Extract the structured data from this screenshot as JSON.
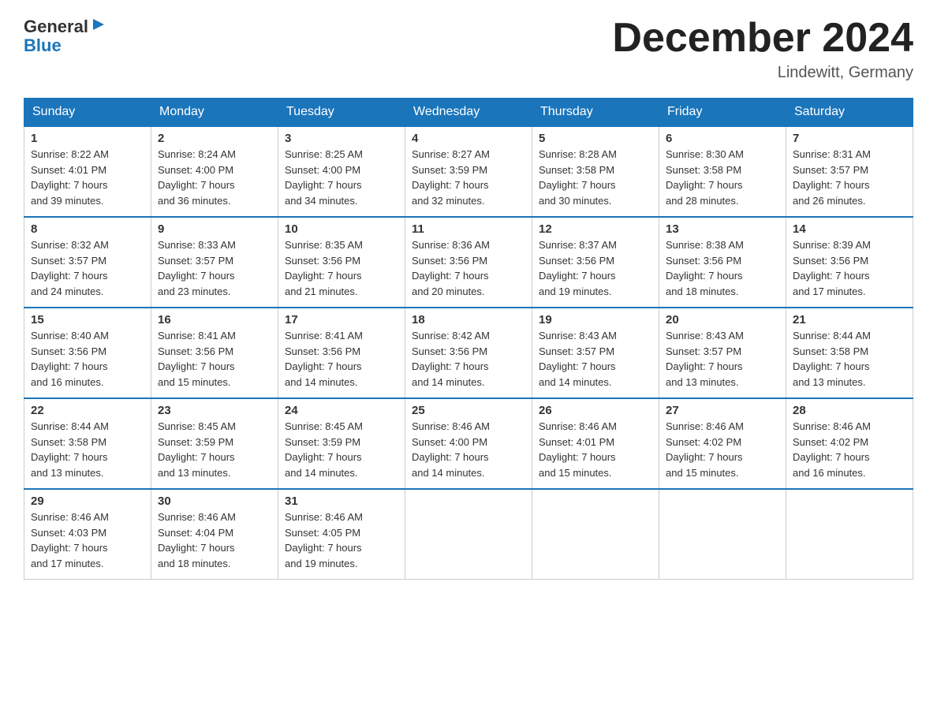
{
  "logo": {
    "text_general": "General",
    "text_blue": "Blue",
    "arrow": "▶"
  },
  "header": {
    "month_year": "December 2024",
    "location": "Lindewitt, Germany"
  },
  "days_of_week": [
    "Sunday",
    "Monday",
    "Tuesday",
    "Wednesday",
    "Thursday",
    "Friday",
    "Saturday"
  ],
  "weeks": [
    [
      {
        "day": "1",
        "sunrise": "8:22 AM",
        "sunset": "4:01 PM",
        "daylight": "7 hours and 39 minutes."
      },
      {
        "day": "2",
        "sunrise": "8:24 AM",
        "sunset": "4:00 PM",
        "daylight": "7 hours and 36 minutes."
      },
      {
        "day": "3",
        "sunrise": "8:25 AM",
        "sunset": "4:00 PM",
        "daylight": "7 hours and 34 minutes."
      },
      {
        "day": "4",
        "sunrise": "8:27 AM",
        "sunset": "3:59 PM",
        "daylight": "7 hours and 32 minutes."
      },
      {
        "day": "5",
        "sunrise": "8:28 AM",
        "sunset": "3:58 PM",
        "daylight": "7 hours and 30 minutes."
      },
      {
        "day": "6",
        "sunrise": "8:30 AM",
        "sunset": "3:58 PM",
        "daylight": "7 hours and 28 minutes."
      },
      {
        "day": "7",
        "sunrise": "8:31 AM",
        "sunset": "3:57 PM",
        "daylight": "7 hours and 26 minutes."
      }
    ],
    [
      {
        "day": "8",
        "sunrise": "8:32 AM",
        "sunset": "3:57 PM",
        "daylight": "7 hours and 24 minutes."
      },
      {
        "day": "9",
        "sunrise": "8:33 AM",
        "sunset": "3:57 PM",
        "daylight": "7 hours and 23 minutes."
      },
      {
        "day": "10",
        "sunrise": "8:35 AM",
        "sunset": "3:56 PM",
        "daylight": "7 hours and 21 minutes."
      },
      {
        "day": "11",
        "sunrise": "8:36 AM",
        "sunset": "3:56 PM",
        "daylight": "7 hours and 20 minutes."
      },
      {
        "day": "12",
        "sunrise": "8:37 AM",
        "sunset": "3:56 PM",
        "daylight": "7 hours and 19 minutes."
      },
      {
        "day": "13",
        "sunrise": "8:38 AM",
        "sunset": "3:56 PM",
        "daylight": "7 hours and 18 minutes."
      },
      {
        "day": "14",
        "sunrise": "8:39 AM",
        "sunset": "3:56 PM",
        "daylight": "7 hours and 17 minutes."
      }
    ],
    [
      {
        "day": "15",
        "sunrise": "8:40 AM",
        "sunset": "3:56 PM",
        "daylight": "7 hours and 16 minutes."
      },
      {
        "day": "16",
        "sunrise": "8:41 AM",
        "sunset": "3:56 PM",
        "daylight": "7 hours and 15 minutes."
      },
      {
        "day": "17",
        "sunrise": "8:41 AM",
        "sunset": "3:56 PM",
        "daylight": "7 hours and 14 minutes."
      },
      {
        "day": "18",
        "sunrise": "8:42 AM",
        "sunset": "3:56 PM",
        "daylight": "7 hours and 14 minutes."
      },
      {
        "day": "19",
        "sunrise": "8:43 AM",
        "sunset": "3:57 PM",
        "daylight": "7 hours and 14 minutes."
      },
      {
        "day": "20",
        "sunrise": "8:43 AM",
        "sunset": "3:57 PM",
        "daylight": "7 hours and 13 minutes."
      },
      {
        "day": "21",
        "sunrise": "8:44 AM",
        "sunset": "3:58 PM",
        "daylight": "7 hours and 13 minutes."
      }
    ],
    [
      {
        "day": "22",
        "sunrise": "8:44 AM",
        "sunset": "3:58 PM",
        "daylight": "7 hours and 13 minutes."
      },
      {
        "day": "23",
        "sunrise": "8:45 AM",
        "sunset": "3:59 PM",
        "daylight": "7 hours and 13 minutes."
      },
      {
        "day": "24",
        "sunrise": "8:45 AM",
        "sunset": "3:59 PM",
        "daylight": "7 hours and 14 minutes."
      },
      {
        "day": "25",
        "sunrise": "8:46 AM",
        "sunset": "4:00 PM",
        "daylight": "7 hours and 14 minutes."
      },
      {
        "day": "26",
        "sunrise": "8:46 AM",
        "sunset": "4:01 PM",
        "daylight": "7 hours and 15 minutes."
      },
      {
        "day": "27",
        "sunrise": "8:46 AM",
        "sunset": "4:02 PM",
        "daylight": "7 hours and 15 minutes."
      },
      {
        "day": "28",
        "sunrise": "8:46 AM",
        "sunset": "4:02 PM",
        "daylight": "7 hours and 16 minutes."
      }
    ],
    [
      {
        "day": "29",
        "sunrise": "8:46 AM",
        "sunset": "4:03 PM",
        "daylight": "7 hours and 17 minutes."
      },
      {
        "day": "30",
        "sunrise": "8:46 AM",
        "sunset": "4:04 PM",
        "daylight": "7 hours and 18 minutes."
      },
      {
        "day": "31",
        "sunrise": "8:46 AM",
        "sunset": "4:05 PM",
        "daylight": "7 hours and 19 minutes."
      },
      null,
      null,
      null,
      null
    ]
  ],
  "labels": {
    "sunrise": "Sunrise: ",
    "sunset": "Sunset: ",
    "daylight": "Daylight: "
  }
}
